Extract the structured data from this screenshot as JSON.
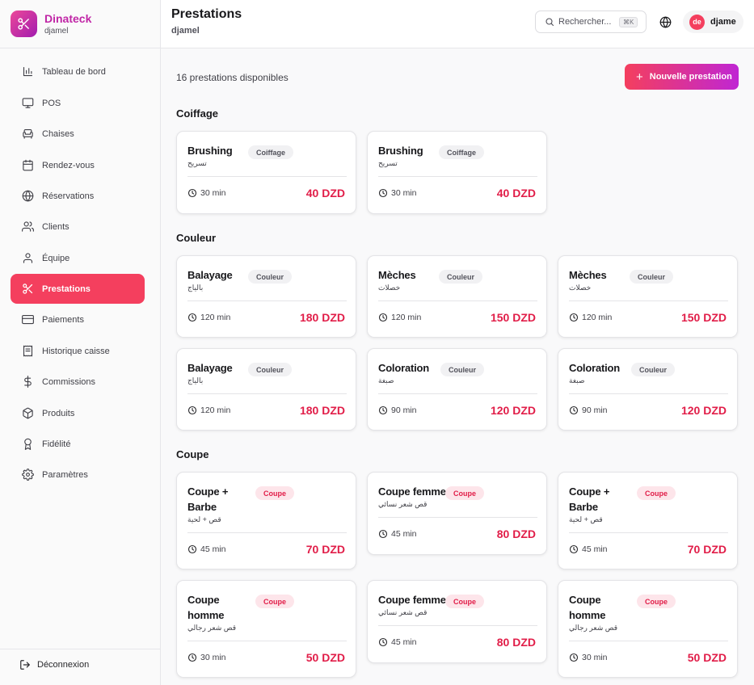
{
  "brand": {
    "name": "Dinateck",
    "subtitle": "djamel"
  },
  "nav": [
    {
      "label": "Tableau de bord",
      "icon": "bar-chart-icon",
      "active": false
    },
    {
      "label": "POS",
      "icon": "monitor-icon",
      "active": false
    },
    {
      "label": "Chaises",
      "icon": "armchair-icon",
      "active": false
    },
    {
      "label": "Rendez-vous",
      "icon": "calendar-icon",
      "active": false
    },
    {
      "label": "Réservations",
      "icon": "globe-icon",
      "active": false
    },
    {
      "label": "Clients",
      "icon": "users-icon",
      "active": false
    },
    {
      "label": "Équipe",
      "icon": "user-icon",
      "active": false
    },
    {
      "label": "Prestations",
      "icon": "scissors-icon",
      "active": true
    },
    {
      "label": "Paiements",
      "icon": "credit-card-icon",
      "active": false
    },
    {
      "label": "Historique caisse",
      "icon": "receipt-icon",
      "active": false
    },
    {
      "label": "Commissions",
      "icon": "dollar-icon",
      "active": false
    },
    {
      "label": "Produits",
      "icon": "package-icon",
      "active": false
    },
    {
      "label": "Fidélité",
      "icon": "award-icon",
      "active": false
    },
    {
      "label": "Paramètres",
      "icon": "gear-icon",
      "active": false
    }
  ],
  "logout": {
    "label": "Déconnexion"
  },
  "header": {
    "title": "Prestations",
    "subtitle": "djamel",
    "search_placeholder": "Rechercher...",
    "search_shortcut": "⌘K",
    "user_initials": "de",
    "user_name": "djame"
  },
  "main": {
    "count_text": "16 prestations disponibles",
    "new_button": "Nouvelle prestation",
    "sections": [
      {
        "title": "Coiffage",
        "cards": [
          {
            "name": "Brushing",
            "arabic": "تسريح",
            "badge": "Coiffage",
            "badge_style": "neutral",
            "duration": "30 min",
            "price": "40 DZD"
          },
          {
            "name": "Brushing",
            "arabic": "تسريح",
            "badge": "Coiffage",
            "badge_style": "neutral",
            "duration": "30 min",
            "price": "40 DZD"
          }
        ]
      },
      {
        "title": "Couleur",
        "cards": [
          {
            "name": "Balayage",
            "arabic": "بالياج",
            "badge": "Couleur",
            "badge_style": "neutral",
            "duration": "120 min",
            "price": "180 DZD"
          },
          {
            "name": "Mèches",
            "arabic": "خصلات",
            "badge": "Couleur",
            "badge_style": "neutral",
            "duration": "120 min",
            "price": "150 DZD"
          },
          {
            "name": "Mèches",
            "arabic": "خصلات",
            "badge": "Couleur",
            "badge_style": "neutral",
            "duration": "120 min",
            "price": "150 DZD"
          },
          {
            "name": "Balayage",
            "arabic": "بالياج",
            "badge": "Couleur",
            "badge_style": "neutral",
            "duration": "120 min",
            "price": "180 DZD"
          },
          {
            "name": "Coloration",
            "arabic": "صبغة",
            "badge": "Couleur",
            "badge_style": "neutral",
            "duration": "90 min",
            "price": "120 DZD"
          },
          {
            "name": "Coloration",
            "arabic": "صبغة",
            "badge": "Couleur",
            "badge_style": "neutral",
            "duration": "90 min",
            "price": "120 DZD"
          }
        ]
      },
      {
        "title": "Coupe",
        "cards": [
          {
            "name": "Coupe + Barbe",
            "arabic": "قص + لحية",
            "badge": "Coupe",
            "badge_style": "pink",
            "duration": "45 min",
            "price": "70 DZD"
          },
          {
            "name": "Coupe femme",
            "arabic": "قص شعر نسائي",
            "badge": "Coupe",
            "badge_style": "pink",
            "duration": "45 min",
            "price": "80 DZD"
          },
          {
            "name": "Coupe + Barbe",
            "arabic": "قص + لحية",
            "badge": "Coupe",
            "badge_style": "pink",
            "duration": "45 min",
            "price": "70 DZD"
          },
          {
            "name": "Coupe homme",
            "arabic": "قص شعر رجالي",
            "badge": "Coupe",
            "badge_style": "pink",
            "duration": "30 min",
            "price": "50 DZD"
          },
          {
            "name": "Coupe femme",
            "arabic": "قص شعر نسائي",
            "badge": "Coupe",
            "badge_style": "pink",
            "duration": "45 min",
            "price": "80 DZD"
          },
          {
            "name": "Coupe homme",
            "arabic": "قص شعر رجالي",
            "badge": "Coupe",
            "badge_style": "pink",
            "duration": "30 min",
            "price": "50 DZD"
          }
        ]
      }
    ]
  },
  "colors": {
    "accent": "#f43f5e",
    "brand": "#c026a6",
    "price": "#e11d48"
  }
}
